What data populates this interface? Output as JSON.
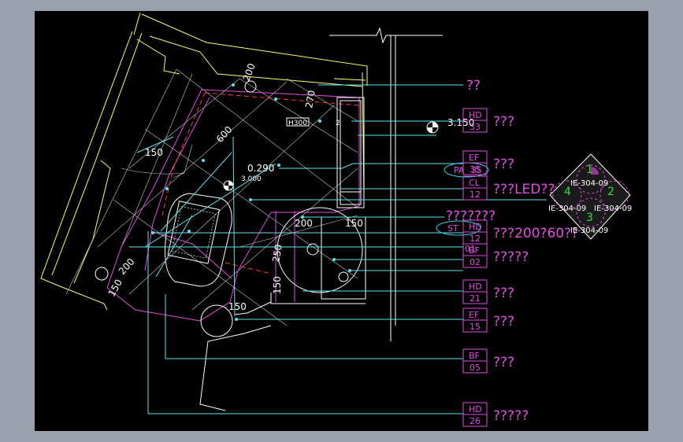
{
  "tags": [
    {
      "code": "HD",
      "num": "33",
      "desc": "???"
    },
    {
      "code": "EF",
      "num": "35",
      "desc": "???"
    },
    {
      "code": "CL",
      "num": "12",
      "desc": "???LED??"
    },
    {
      "code": "HD",
      "num": "12",
      "desc": "???200?60??"
    },
    {
      "code": "BF",
      "num": "02",
      "desc": "?????"
    },
    {
      "code": "HD",
      "num": "21",
      "desc": "???"
    },
    {
      "code": "EF",
      "num": "15",
      "desc": "???"
    },
    {
      "code": "BF",
      "num": "05",
      "desc": "???"
    },
    {
      "code": "HD",
      "num": "26",
      "desc": "?????"
    }
  ],
  "callouts": {
    "top": "??",
    "pa_code": "PA",
    "pa_num": "35",
    "st_code": "ST",
    "st_num": "01",
    "middle": "???????"
  },
  "level_marks": {
    "right": "3.150",
    "left": "3.000"
  },
  "dimensions": {
    "d600": "600",
    "d200": "200",
    "d150a": "150",
    "d150b": "150",
    "d150c": "150",
    "d150d": "150",
    "d200b": "200",
    "d200c": "200",
    "d270": "270",
    "d250": "250",
    "d0290": "0.290",
    "d3000": "3.000",
    "d150e": "150"
  },
  "detail_marker": {
    "q1": "1",
    "q2": "2",
    "q3": "3",
    "q4": "4",
    "ref_top": "IE-304-09",
    "ref_left": "IE-304-09",
    "ref_right": "IE-304-09",
    "ref_bottom": "IE-304-09"
  },
  "colors": {
    "background": "#000000",
    "frame": "#98a0ab",
    "tag": "#e24ce2",
    "leader": "#5ee3ee",
    "wall": "#ffff66",
    "detail_number": "#38d838"
  }
}
